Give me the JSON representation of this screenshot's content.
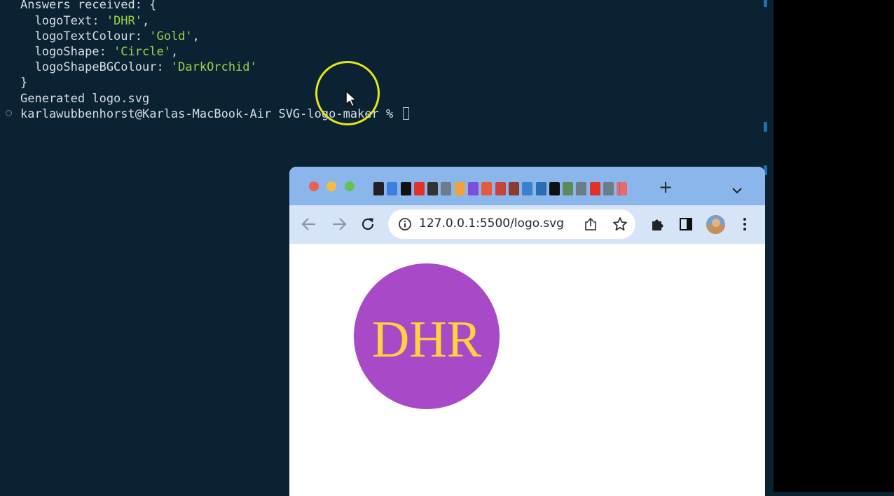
{
  "terminal": {
    "lines": [
      "Answers received: {",
      "  logoText: ",
      "  logoTextColour: ",
      "  logoShape: ",
      "  logoShapeBGColour: ",
      "}",
      "Generated logo.svg",
      "karlawubbenhorst@Karlas-MacBook-Air SVG-logo-maker % "
    ],
    "values": {
      "logoText": "'DHR'",
      "logoTextColour": "'Gold'",
      "logoShape": "'Circle'",
      "logoShapeBGColour": "'DarkOrchid'"
    },
    "trailing_comma": ","
  },
  "browser": {
    "url": "127.0.0.1:5500/logo.svg",
    "newtab_label": "+"
  },
  "logo": {
    "text": "DHR",
    "text_color": "#ffd23f",
    "shape": "circle",
    "fill": "#a84ac7"
  },
  "colors": {
    "terminal_bg": "#0b2233",
    "terminal_text": "#d6dde3",
    "string_color": "#9ad64a",
    "highlight_ring": "#e6e61a",
    "tabstrip_bg": "#8ab6ec",
    "toolbar_bg": "#d5e4f6"
  }
}
